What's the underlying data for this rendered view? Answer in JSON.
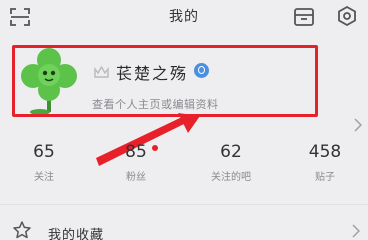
{
  "header": {
    "title": "我的",
    "left_icon": "scan-icon",
    "right_icons": [
      "store-icon",
      "settings-icon"
    ]
  },
  "profile": {
    "username": "苌楚之殇",
    "subtitle": "查看个人主页或编辑资料",
    "avatar": "clover-avatar",
    "badges": [
      "crown-icon",
      "verify-badge"
    ]
  },
  "stats": [
    {
      "value": "65",
      "label": "关注"
    },
    {
      "value": "85",
      "label": "粉丝",
      "has_dot": true
    },
    {
      "value": "62",
      "label": "关注的吧"
    },
    {
      "value": "458",
      "label": "贴子"
    }
  ],
  "menu": {
    "favorites_label": "我的收藏"
  },
  "colors": {
    "background": "#eeeef0",
    "highlight": "#e8202a",
    "verify_blue": "#4a8fe0",
    "avatar_green": "#5cc24a"
  }
}
